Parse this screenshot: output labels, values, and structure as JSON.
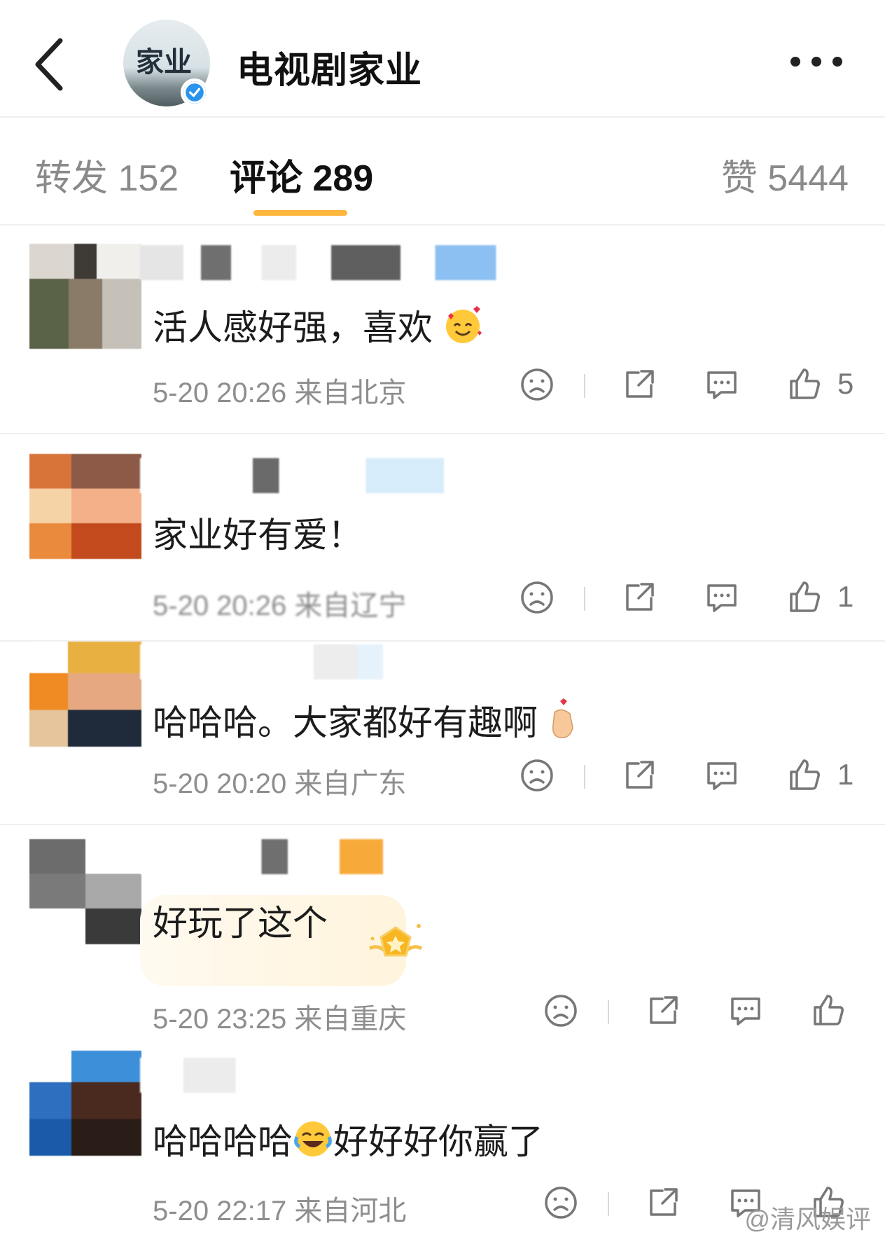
{
  "header": {
    "avatar_text": "家业",
    "title": "电视剧家业"
  },
  "tabs": {
    "repost": "转发 152",
    "comments": "评论 289",
    "likes": "赞 5444"
  },
  "comments": [
    {
      "text": "活人感好强，喜欢",
      "emoji": "smiling-face-with-hearts-emoji",
      "meta": "5-20 20:26 来自北京",
      "likes": "5"
    },
    {
      "text": "家业好有爱！",
      "meta": "5-20 20:26 来自辽宁",
      "likes": "1"
    },
    {
      "text": "哈哈哈。大家都好有趣啊",
      "emoji": "finger-heart-emoji",
      "meta": "5-20 20:20 来自广东",
      "likes": "1"
    },
    {
      "text": "好玩了这个",
      "meta": "5-20 23:25 来自重庆",
      "likes": ""
    },
    {
      "text_a": "哈哈哈哈",
      "emoji": "tears-of-joy-emoji",
      "text_b": "好好好你赢了",
      "meta": "5-20 22:17 来自河北",
      "likes": ""
    }
  ],
  "watermark": "@清风娱评",
  "colors": {
    "accent": "#ffb43a",
    "verified": "#2a94ec",
    "muted": "#8e8e8e"
  }
}
